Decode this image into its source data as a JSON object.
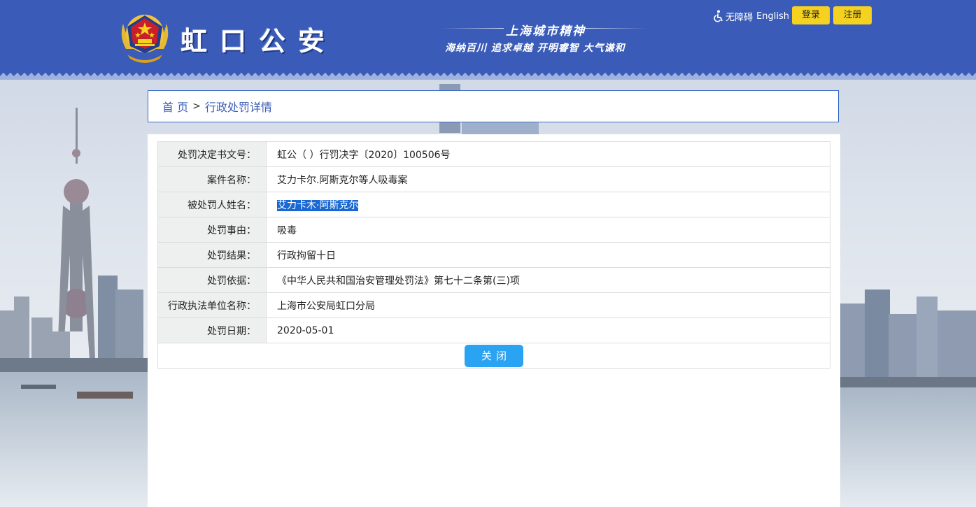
{
  "header": {
    "site_title": "虹口公安",
    "spirit_title": "上海城市精神",
    "spirit_motto": "海纳百川 追求卓越 开明睿智 大气谦和",
    "accessibility_label": "无障碍",
    "english_label": "English",
    "login_label": "登录",
    "register_label": "注册"
  },
  "breadcrumb": {
    "home": "首 页",
    "separator": ">",
    "current": "行政处罚详情"
  },
  "detail": {
    "rows": [
      {
        "label": "处罚决定书文号：",
        "value": "虹公（ ）行罚决字〔2020〕100506号"
      },
      {
        "label": "案件名称：",
        "value": "艾力卡尔.阿斯克尔等人吸毒案"
      },
      {
        "label": "被处罚人姓名：",
        "value": "艾力卡木·阿斯克尔"
      },
      {
        "label": "处罚事由：",
        "value": "吸毒"
      },
      {
        "label": "处罚结果：",
        "value": "行政拘留十日"
      },
      {
        "label": "处罚依据：",
        "value": "《中华人民共和国治安管理处罚法》第七十二条第(三)项"
      },
      {
        "label": "行政执法单位名称：",
        "value": "上海市公安局虹口分局"
      },
      {
        "label": "处罚日期：",
        "value": "2020-05-01"
      }
    ],
    "close_label": "关闭"
  },
  "colors": {
    "header_blue": "#3a5cb8",
    "button_yellow": "#f5d220",
    "close_button_blue": "#29a3f2",
    "selection_blue": "#1967d2"
  },
  "icons": {
    "emblem": "police-emblem-icon",
    "accessibility": "wheelchair-icon"
  }
}
